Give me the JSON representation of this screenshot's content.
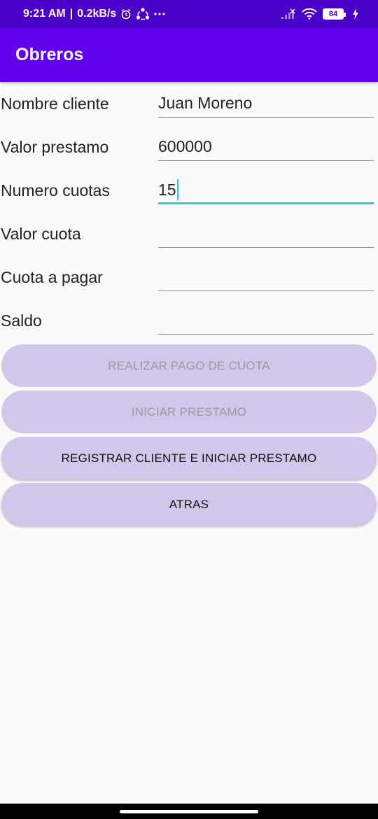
{
  "status_bar": {
    "time": "9:21 AM",
    "speed": "0.2kB/s",
    "battery": "84",
    "icons": [
      "alarm-icon",
      "sync-icon",
      "more-dots-icon",
      "signal-icon",
      "wifi-icon",
      "battery-icon",
      "charging-icon"
    ]
  },
  "app_bar": {
    "title": "Obreros"
  },
  "form": {
    "fields": [
      {
        "label": "Nombre cliente",
        "value": "Juan Moreno"
      },
      {
        "label": "Valor prestamo",
        "value": "600000"
      },
      {
        "label": "Numero cuotas",
        "value": "15"
      },
      {
        "label": "Valor cuota",
        "value": ""
      },
      {
        "label": "Cuota a pagar",
        "value": ""
      },
      {
        "label": "Saldo",
        "value": ""
      }
    ]
  },
  "buttons": [
    {
      "label": "REALIZAR PAGO DE CUOTA",
      "enabled": false
    },
    {
      "label": "INICIAR PRESTAMO",
      "enabled": false
    },
    {
      "label": "REGISTRAR CLIENTE E INICIAR PRESTAMO",
      "enabled": true
    },
    {
      "label": "ATRAS",
      "enabled": true
    }
  ],
  "colors": {
    "status_bar": "#4a00c8",
    "app_bar": "#6200ee",
    "button": "#d2c6ea",
    "focus_accent": "#26d0c8"
  }
}
